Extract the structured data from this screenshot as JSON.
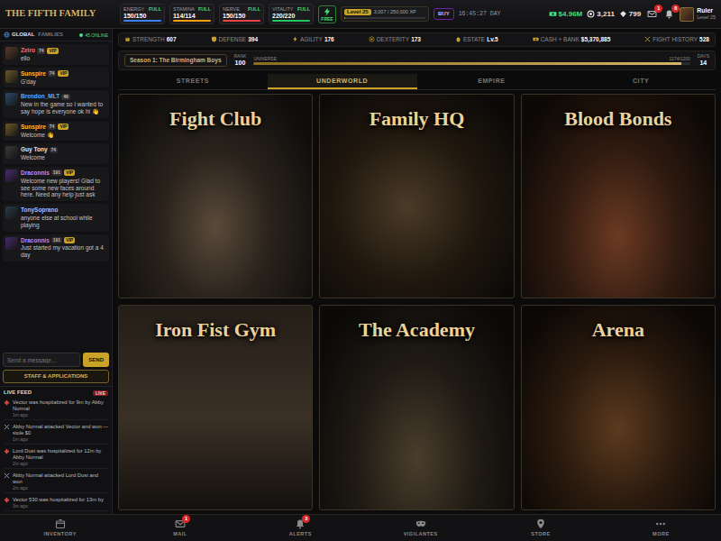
{
  "logo": "THE FIFTH FAMILY",
  "vitals": [
    {
      "label": "ENERGY",
      "value": "150/150",
      "tag": "FULL",
      "level": 1,
      "color": "#3b82f6"
    },
    {
      "label": "STAMINA",
      "value": "114/114",
      "tag": "FULL",
      "level": 1,
      "color": "#f59e0b"
    },
    {
      "label": "NERVE",
      "value": "150/150",
      "tag": "FULL",
      "level": 1,
      "color": "#ef4444"
    },
    {
      "label": "VITALITY",
      "value": "220/220",
      "tag": "FULL",
      "level": 1,
      "color": "#22c55e"
    }
  ],
  "free_refill": {
    "label": "FREE"
  },
  "player_level": {
    "label": "Level 25",
    "xp": "3,007 / 250,000 XP",
    "level": 0.012
  },
  "boost": {
    "label": "BUY"
  },
  "clock": "16:45:27 DAY",
  "currencies": [
    {
      "value": "$4.96M",
      "color": "#4ade80"
    },
    {
      "value": "3,211",
      "color": "#e5e5e5"
    },
    {
      "value": "799",
      "color": "#e5e5e5"
    }
  ],
  "alerts": [
    {
      "count": "1"
    },
    {
      "count": "8"
    }
  ],
  "user": {
    "name": "Ruler",
    "level": "Level 25"
  },
  "chat": {
    "tabs": [
      {
        "label": "GLOBAL",
        "selected": true
      },
      {
        "label": "FAMILIES",
        "selected": false
      }
    ],
    "online": "45 ONLINE",
    "messages": [
      {
        "name": "Zeiro",
        "color": "#f87171",
        "badges": [
          {
            "text": "74",
            "kind": "level"
          },
          {
            "text": "VIP",
            "kind": "vip"
          }
        ],
        "text": "ello"
      },
      {
        "name": "Sunspire",
        "color": "#fbbf24",
        "badges": [
          {
            "text": "74",
            "kind": "level"
          },
          {
            "text": "VIP",
            "kind": "vip"
          }
        ],
        "text": "G'day"
      },
      {
        "name": "Brendon_MLT",
        "color": "#60a5fa",
        "badges": [
          {
            "text": "46",
            "kind": "level"
          }
        ],
        "text": "New in the game so I wanted to say hope is everyone ok hi 👋"
      },
      {
        "name": "Sunspire",
        "color": "#fbbf24",
        "badges": [
          {
            "text": "74",
            "kind": "level"
          },
          {
            "text": "VIP",
            "kind": "vip"
          }
        ],
        "text": "Welcome 👋"
      },
      {
        "name": "Guy Tony",
        "color": "#e5e5e5",
        "badges": [
          {
            "text": "74",
            "kind": "level"
          }
        ],
        "text": "Welcome"
      },
      {
        "name": "Draconnis",
        "color": "#c084fc",
        "badges": [
          {
            "text": "191",
            "kind": "level"
          },
          {
            "text": "VIP",
            "kind": "vip"
          }
        ],
        "text": "Welcome new players! Glad to see some new faces around here. Need any help just ask"
      },
      {
        "name": "TonySoprano",
        "color": "#93c5fd",
        "badges": [],
        "text": "anyone else at school while playing"
      },
      {
        "name": "Draconnis",
        "color": "#c084fc",
        "badges": [
          {
            "text": "191",
            "kind": "level"
          },
          {
            "text": "VIP",
            "kind": "vip"
          }
        ],
        "text": "Just started my vacation got a 4 day"
      }
    ],
    "placeholder": "Send a message...",
    "send": "SEND"
  },
  "staff_button": "STAFF & APPLICATIONS",
  "live_feed": {
    "title": "LIVE FEED",
    "badge": "LIVE",
    "items": [
      {
        "kind": "hospital",
        "text": "Vector was hospitalized for 9m by Abby Normal",
        "time": "1m ago"
      },
      {
        "kind": "attack",
        "text": "Abby Normal attacked Vector and won — stole $0",
        "time": "1m ago"
      },
      {
        "kind": "hospital",
        "text": "Lord Dust was hospitalized for 12m by Abby Normal",
        "time": "2m ago"
      },
      {
        "kind": "attack",
        "text": "Abby Normal attacked Lord Dust and won",
        "time": "2m ago"
      },
      {
        "kind": "hospital",
        "text": "Vector 530 was hospitalized for 13m by",
        "time": "3m ago"
      }
    ]
  },
  "stats": [
    {
      "label": "STRENGTH",
      "value": "607"
    },
    {
      "label": "DEFENSE",
      "value": "394"
    },
    {
      "label": "AGILITY",
      "value": "176"
    },
    {
      "label": "DEXTERITY",
      "value": "173"
    },
    {
      "label": "ESTATE",
      "value": "Lv.5"
    },
    {
      "label": "CASH + BANK",
      "value": "$5,370,885"
    },
    {
      "label": "FIGHT HISTORY",
      "value": "528"
    }
  ],
  "season": {
    "title": "Season 1: The Birmingham Boys",
    "rank_label": "RANK",
    "rank": "100",
    "bar_label": "UNIVERSE",
    "reading": "1174/1200",
    "level": 0.98,
    "days_label": "DAYS",
    "days": "14"
  },
  "tabs": [
    {
      "label": "STREETS",
      "selected": false
    },
    {
      "label": "UNDERWORLD",
      "selected": true
    },
    {
      "label": "EMPIRE",
      "selected": false
    },
    {
      "label": "CITY",
      "selected": false
    }
  ],
  "locations": [
    {
      "title": "Fight Club"
    },
    {
      "title": "Family HQ"
    },
    {
      "title": "Blood Bonds"
    },
    {
      "title": "Iron Fist Gym"
    },
    {
      "title": "The Academy"
    },
    {
      "title": "Arena"
    }
  ],
  "bottom_nav": [
    {
      "label": "INVENTORY"
    },
    {
      "label": "MAIL",
      "badge": "1"
    },
    {
      "label": "ALERTS",
      "badge": "3"
    },
    {
      "label": "VIGILANTES"
    },
    {
      "label": "STORE"
    },
    {
      "label": "MORE"
    }
  ]
}
